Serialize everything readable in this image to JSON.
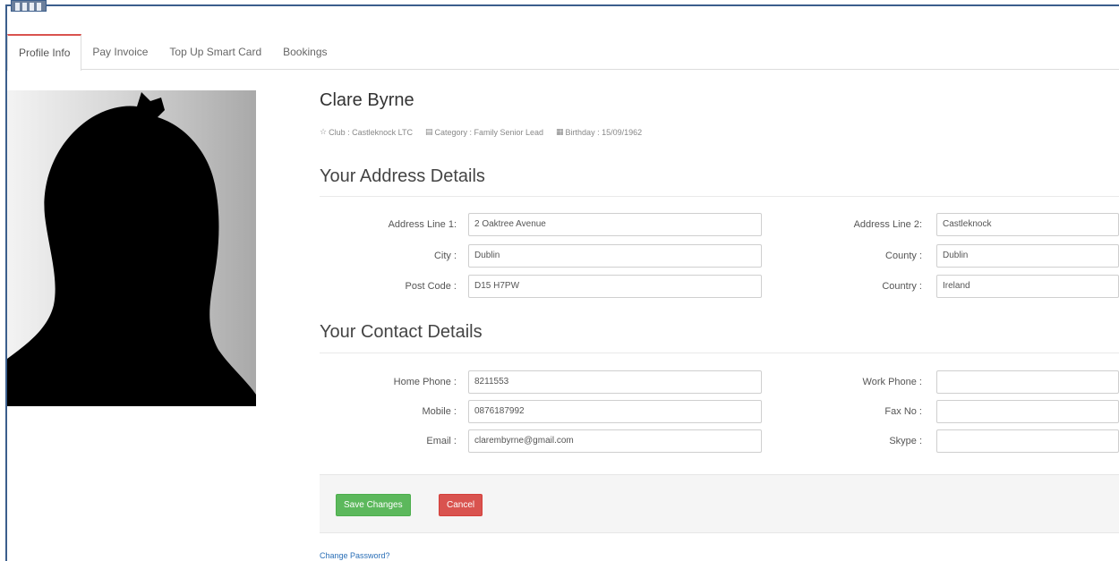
{
  "tabs": [
    {
      "label": "Profile Info",
      "active": true
    },
    {
      "label": "Pay Invoice",
      "active": false
    },
    {
      "label": "Top Up Smart Card",
      "active": false
    },
    {
      "label": "Bookings",
      "active": false
    }
  ],
  "profile": {
    "name": "Clare Byrne",
    "club": "Club : Castleknock LTC",
    "category": "Category : Family Senior Lead",
    "birthday": "Birthday : 15/09/1962"
  },
  "address": {
    "title": "Your Address Details",
    "line1_label": "Address Line 1:",
    "line1_value": "2 Oaktree Avenue",
    "line2_label": "Address Line 2:",
    "line2_value": "Castleknock",
    "city_label": "City :",
    "city_value": "Dublin",
    "county_label": "County :",
    "county_value": "Dublin",
    "postcode_label": "Post Code :",
    "postcode_value": "D15 H7PW",
    "country_label": "Country :",
    "country_value": "Ireland"
  },
  "contact": {
    "title": "Your Contact Details",
    "home_label": "Home Phone :",
    "home_value": "8211553",
    "work_label": "Work Phone :",
    "work_value": "",
    "mobile_label": "Mobile :",
    "mobile_value": "0876187992",
    "fax_label": "Fax No :",
    "fax_value": "",
    "email_label": "Email :",
    "email_value": "clarembyrne@gmail.com",
    "skype_label": "Skype :",
    "skype_value": ""
  },
  "actions": {
    "save_label": "Save Changes",
    "cancel_label": "Cancel",
    "change_password": "Change Password?"
  },
  "colors": {
    "save": "#5cb85c",
    "cancel": "#d9534f",
    "active_tab_accent": "#d9534f",
    "link": "#2a6fb7"
  }
}
